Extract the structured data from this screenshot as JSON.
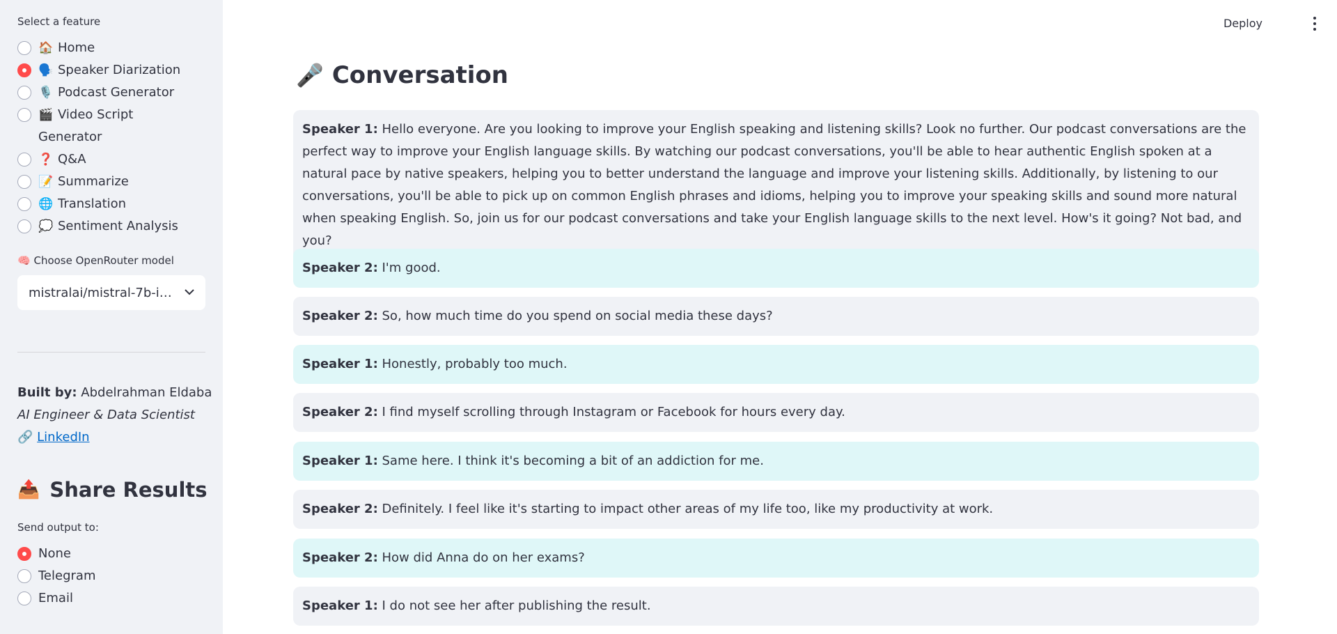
{
  "sidebar": {
    "feature_label": "Select a feature",
    "features": [
      {
        "emoji": "🏠",
        "label": "Home",
        "selected": false
      },
      {
        "emoji": "🗣️",
        "label": "Speaker Diarization",
        "selected": true
      },
      {
        "emoji": "🎙️",
        "label": "Podcast Generator",
        "selected": false
      },
      {
        "emoji": "🎬",
        "label": "Video Script Generator",
        "selected": false
      },
      {
        "emoji": "❓",
        "label": "Q&A",
        "selected": false
      },
      {
        "emoji": "📝",
        "label": "Summarize",
        "selected": false
      },
      {
        "emoji": "🌐",
        "label": "Translation",
        "selected": false
      },
      {
        "emoji": "💭",
        "label": "Sentiment Analysis",
        "selected": false
      }
    ],
    "model_label_emoji": "🧠",
    "model_label": "Choose OpenRouter model",
    "model_value": "mistralai/mistral-7b-i…",
    "built_by_label": "Built by:",
    "built_by_name": "Abdelrahman Eldaba",
    "role": "AI Engineer & Data Scientist",
    "link_emoji": "🔗",
    "link_label": "LinkedIn",
    "share_emoji": "📤",
    "share_title": "Share Results",
    "send_label": "Send output to:",
    "send_options": [
      {
        "label": "None",
        "selected": true
      },
      {
        "label": "Telegram",
        "selected": false
      },
      {
        "label": "Email",
        "selected": false
      }
    ]
  },
  "topbar": {
    "deploy_label": "Deploy"
  },
  "main": {
    "title_emoji": "🎤",
    "title": "Conversation",
    "messages": [
      {
        "speaker": "Speaker 1:",
        "text": "Hello everyone. Are you looking to improve your English speaking and listening skills? Look no further. Our podcast conversations are the perfect way to improve your English language skills. By watching our podcast conversations, you'll be able to hear authentic English spoken at a natural pace by native speakers, helping you to better understand the language and improve your listening skills. Additionally, by listening to our conversations, you'll be able to pick up on common English phrases and idioms, helping you to improve your speaking skills and sound more natural when speaking English. So, join us for our podcast conversations and take your English language skills to the next level. How's it going? Not bad, and you?"
      },
      {
        "speaker": "Speaker 2:",
        "text": "I'm good."
      },
      {
        "speaker": "Speaker 2:",
        "text": "So, how much time do you spend on social media these days?"
      },
      {
        "speaker": "Speaker 1:",
        "text": "Honestly, probably too much."
      },
      {
        "speaker": "Speaker 2:",
        "text": "I find myself scrolling through Instagram or Facebook for hours every day."
      },
      {
        "speaker": "Speaker 1:",
        "text": "Same here. I think it's becoming a bit of an addiction for me."
      },
      {
        "speaker": "Speaker 2:",
        "text": "Definitely. I feel like it's starting to impact other areas of my life too, like my productivity at work."
      },
      {
        "speaker": "Speaker 2:",
        "text": "How did Anna do on her exams?"
      },
      {
        "speaker": "Speaker 1:",
        "text": "I do not see her after publishing the result."
      }
    ]
  },
  "colors": {
    "accent": "#ff4b4b",
    "sidebar_bg": "#f0f2f6",
    "msg_grey": "#f0f2f6",
    "msg_cyan": "#dff7f8",
    "link": "#0068c9"
  }
}
